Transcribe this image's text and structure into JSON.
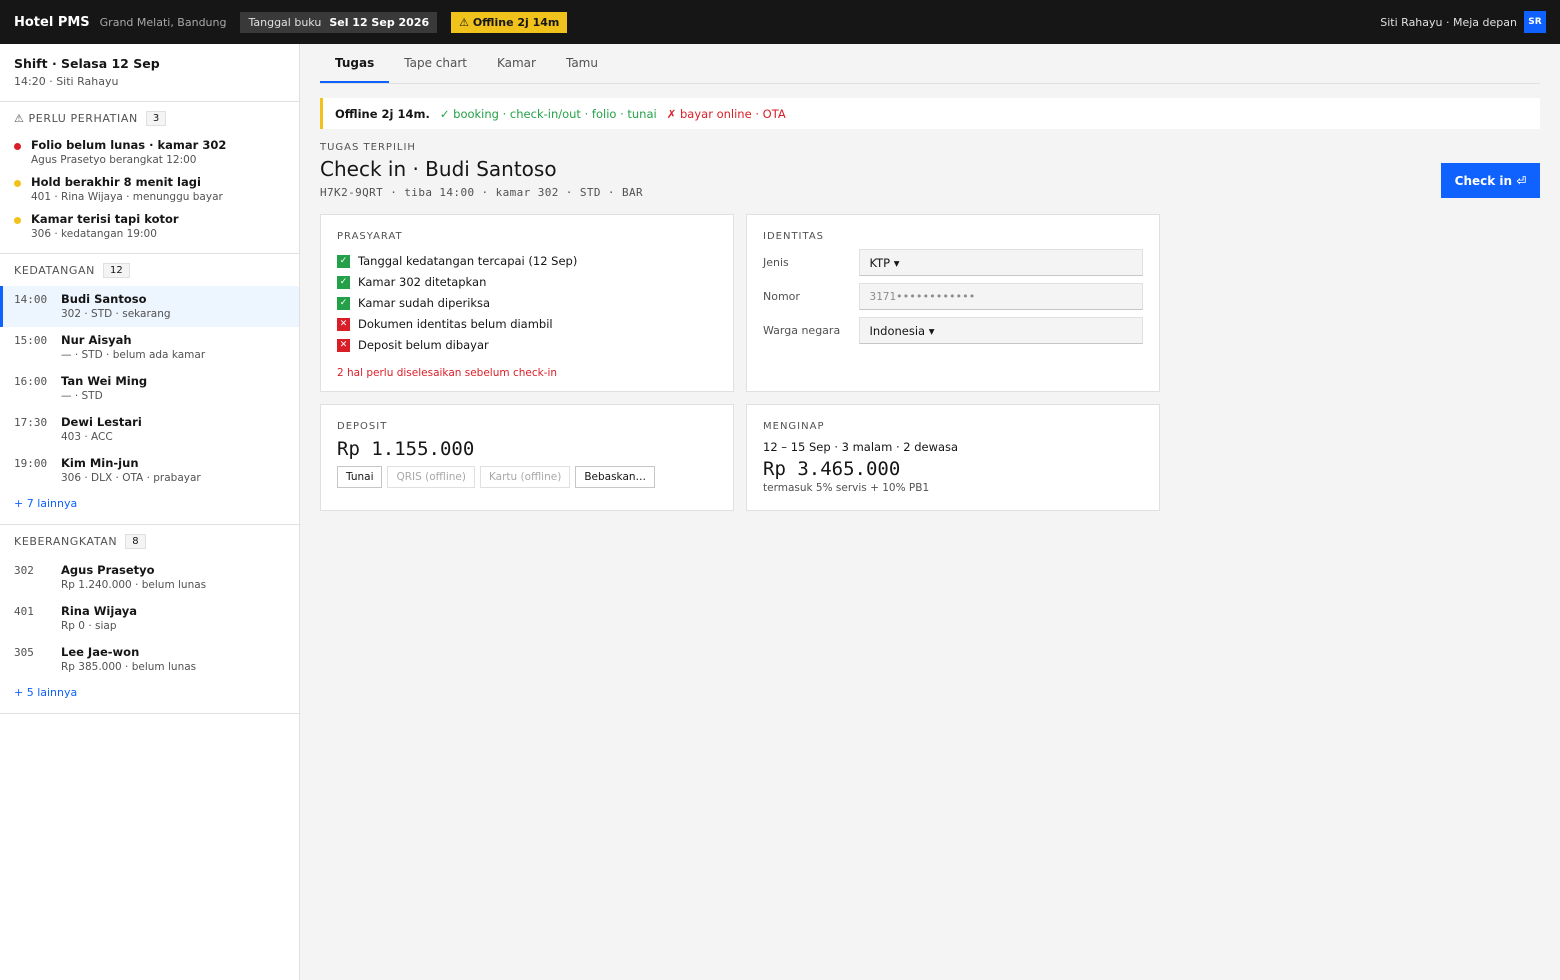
{
  "topbar": {
    "brand": "Hotel PMS",
    "hotel": "Grand Melati, Bandung",
    "book_label": "Tanggal buku",
    "book_date": "Sel 12 Sep 2026",
    "offline_chip": "⚠ Offline 2j 14m",
    "user": "Siti Rahayu · Meja depan",
    "avatar": "SR"
  },
  "shift": {
    "title": "Shift · Selasa 12 Sep",
    "sub": "14:20 · Siti Rahayu"
  },
  "attention": {
    "label": "⚠ PERLU PERHATIAN",
    "count": "3",
    "items": [
      {
        "title": "Folio belum lunas · kamar 302",
        "sub": "Agus Prasetyo berangkat 12:00",
        "color": "#da1e28"
      },
      {
        "title": "Hold berakhir 8 menit lagi",
        "sub": "401 · Rina Wijaya · menunggu bayar",
        "color": "#f1c21b"
      },
      {
        "title": "Kamar terisi tapi kotor",
        "sub": "306 · kedatangan 19:00",
        "color": "#f1c21b"
      }
    ]
  },
  "arrivals": {
    "label": "KEDATANGAN",
    "count": "12",
    "items": [
      {
        "time": "14:00",
        "name": "Budi Santoso",
        "sub": "302 · STD · sekarang"
      },
      {
        "time": "15:00",
        "name": "Nur Aisyah",
        "sub": "— · STD · belum ada kamar"
      },
      {
        "time": "16:00",
        "name": "Tan Wei Ming",
        "sub": "— · STD"
      },
      {
        "time": "17:30",
        "name": "Dewi Lestari",
        "sub": "403 · ACC"
      },
      {
        "time": "19:00",
        "name": "Kim Min-jun",
        "sub": "306 · DLX · OTA · prabayar"
      }
    ],
    "more": "+ 7 lainnya"
  },
  "departures": {
    "label": "KEBERANGKATAN",
    "count": "8",
    "items": [
      {
        "room": "302",
        "name": "Agus Prasetyo",
        "sub": "Rp 1.240.000 · belum lunas"
      },
      {
        "room": "401",
        "name": "Rina Wijaya",
        "sub": "Rp 0 · siap"
      },
      {
        "room": "305",
        "name": "Lee Jae-won",
        "sub": "Rp 385.000 · belum lunas"
      }
    ],
    "more": "+ 5 lainnya"
  },
  "tabs": [
    "Tugas",
    "Tape chart",
    "Kamar",
    "Tamu"
  ],
  "banner": {
    "title": "Offline 2j 14m.",
    "ok": "✓ booking · check-in/out · folio · tunai",
    "bad": "✗ bayar online · OTA"
  },
  "task": {
    "overline": "TUGAS TERPILIH",
    "title": "Check in · Budi Santoso",
    "sub": "H7K2-9QRT · tiba 14:00 · kamar 302 · STD · BAR",
    "button": "Check in ⏎"
  },
  "prereq": {
    "label": "PRASYARAT",
    "items": [
      {
        "text": "Tanggal kedatangan tercapai (12 Sep)",
        "ok": true
      },
      {
        "text": "Kamar 302 ditetapkan",
        "ok": true
      },
      {
        "text": "Kamar sudah diperiksa",
        "ok": true
      },
      {
        "text": "Dokumen identitas belum diambil",
        "ok": false
      },
      {
        "text": "Deposit belum dibayar",
        "ok": false
      }
    ],
    "warning": "2 hal perlu diselesaikan sebelum check-in"
  },
  "identity": {
    "label": "IDENTITAS",
    "type_label": "Jenis",
    "type_value": "KTP ▾",
    "number_label": "Nomor",
    "number_value": "3171••••••••••••",
    "nation_label": "Warga negara",
    "nation_value": "Indonesia ▾"
  },
  "deposit": {
    "label": "DEPOSIT",
    "amount": "Rp 1.155.000",
    "methods": [
      {
        "label": "Tunai",
        "disabled": false
      },
      {
        "label": "QRIS (offline)",
        "disabled": true
      },
      {
        "label": "Kartu (offline)",
        "disabled": true
      },
      {
        "label": "Bebaskan…",
        "disabled": false
      }
    ]
  },
  "stay": {
    "label": "MENGINAP",
    "dates": "12 – 15 Sep · 3 malam · 2 dewasa",
    "amount": "Rp 3.465.000",
    "note": "termasuk 5% servis + 10% PB1"
  }
}
